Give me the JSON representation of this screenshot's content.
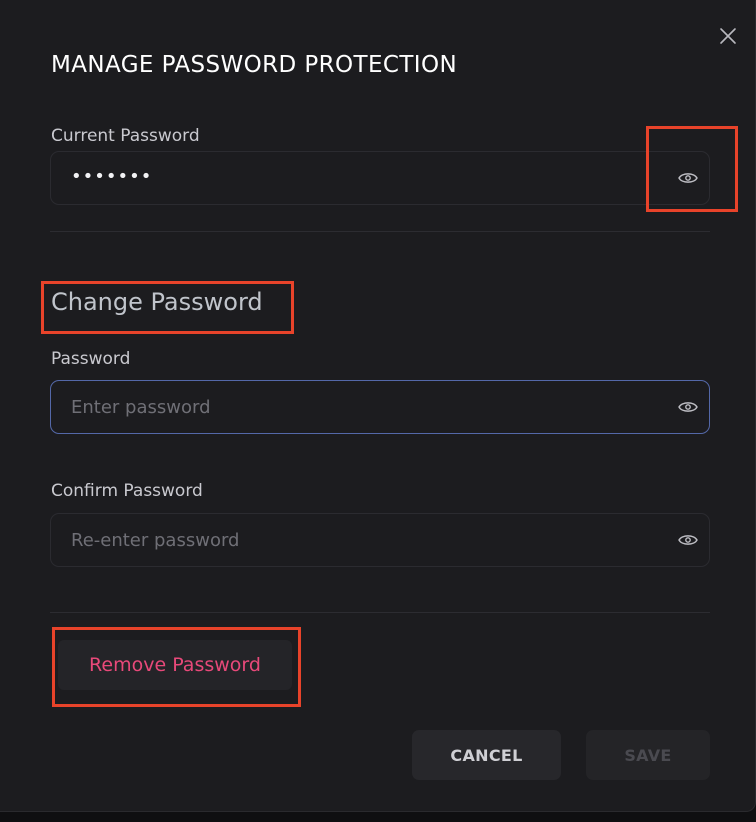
{
  "modal": {
    "title": "MANAGE PASSWORD PROTECTION",
    "close_icon": "close-icon"
  },
  "current_password": {
    "label": "Current Password",
    "value": "•••••••",
    "toggle_icon": "eye-icon"
  },
  "change_section": {
    "title": "Change Password"
  },
  "new_password": {
    "label": "Password",
    "placeholder": "Enter password",
    "toggle_icon": "eye-icon"
  },
  "confirm_password": {
    "label": "Confirm Password",
    "placeholder": "Re-enter password",
    "toggle_icon": "eye-icon"
  },
  "actions": {
    "remove_label": "Remove Password",
    "cancel_label": "CANCEL",
    "save_label": "SAVE"
  },
  "colors": {
    "background": "#1c1c1f",
    "accent_focus": "#5468a8",
    "danger": "#e8497a",
    "highlight": "#e8432a"
  }
}
